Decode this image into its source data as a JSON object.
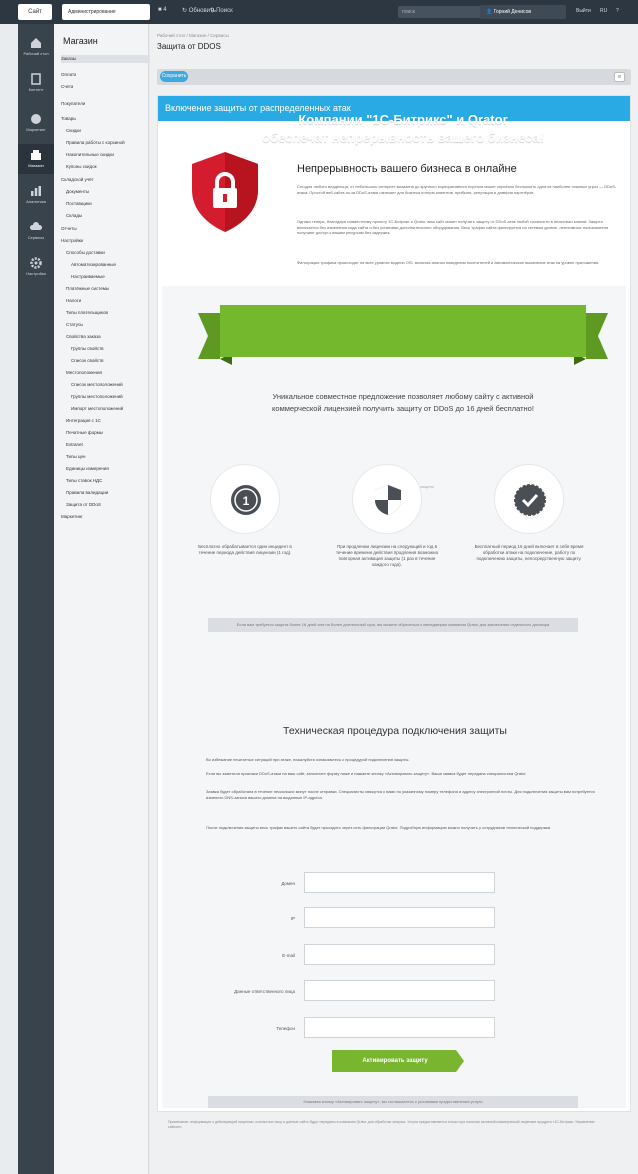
{
  "topbar": {
    "site_btn": "Сайт",
    "admin_btn": "Администрирование",
    "icons": [
      "4",
      "Обновить",
      "Поиск"
    ],
    "search_placeholder": "поиск",
    "user": "Горний Денисов",
    "right_links": [
      "Выйти",
      "RU",
      "?"
    ]
  },
  "leftbar": {
    "items": [
      {
        "label": "Рабочий стол",
        "icon": "home-icon"
      },
      {
        "label": "Контент",
        "icon": "document-icon"
      },
      {
        "label": "Маркетинг",
        "icon": "marketing-icon"
      },
      {
        "label": "Магазин",
        "icon": "store-icon"
      },
      {
        "label": "Аналитика",
        "icon": "chart-icon"
      },
      {
        "label": "Сервисы",
        "icon": "cloud-icon"
      },
      {
        "label": "Настройки",
        "icon": "gear-icon"
      }
    ]
  },
  "menu": {
    "title": "Магазин",
    "items": [
      "Заказы",
      "Оплата",
      "Счета",
      "Покупатели",
      "Товары",
      "Скидки",
      "Правила работы с корзиной",
      "Накопительные скидки",
      "Купоны скидок",
      "Складской учёт",
      "Документы",
      "Поставщики",
      "Склады",
      "Отчеты",
      "Настройки",
      "Способы доставки",
      "Автоматизированные",
      "Настраиваемые",
      "Платёжные системы",
      "Налоги",
      "Типы плательщиков",
      "Статусы",
      "Свойства заказа",
      "Группы свойств",
      "Список свойств",
      "Местоположения",
      "Список местоположений",
      "Группы местоположений",
      "Импорт местоположений",
      "Интеграция с 1С",
      "Печатные формы",
      "Extranet",
      "Типы цен",
      "Единицы измерения",
      "Типы ставок НДС",
      "Правила валидации",
      "Защита от DDoS",
      "Маркетинг"
    ]
  },
  "header": {
    "breadcrumb": "Рабочий стол  /  Магазин  /  Сервисы",
    "title": "Защита от DDOS",
    "save_label": "Сохранить",
    "menu_btn": "☰"
  },
  "panel": {
    "banner": "Включение защиты от распределенных атак",
    "intro_title": "Непрерывность вашего бизнеса в онлайне",
    "intro_p1": "Сегодня любого владельца, от небольшого интернет-магазина до крупного корпоративного портала может серьёзно беспокоить одна из наиболее опасных угроз — DDoS-атака. Простой веб-сайта из-за DDoS-атаки означает для бизнеса потерю клиентов, прибыли, репутации и доверия партнёров.",
    "intro_p2": "Однако теперь, благодаря совместному проекту 1С-Битрикс и Qrator, ваш сайт может получать защиту от DDoS-атак любой сложности в несколько кликов. Защита включается без изменения кода сайта и без установки дополнительного оборудования. Весь трафик сайта фильтруется на сетевом уровне, легитимные пользователи получают доступ к вашим ресурсам без задержек.",
    "intro_p3": "Фильтрация трафика происходит на всех уровнях модели OSI, включая анализ поведения посетителей и автоматическое выявление атак на уровне приложения.",
    "ribbon_line1": "Компании \"1С-Битрикс\" и Qrator",
    "ribbon_line2": "обеспечат непрерывность вашего бизнеса!",
    "offer_line1": "Уникальное совместное предложение позволяет любому сайту с активной",
    "offer_line2": "коммерческой лицензией получить защиту от DDoS до 16 дней бесплатно!",
    "offer_note": "Условия предоставления защиты",
    "features": [
      {
        "text": "Бесплатно обрабатывается один инцидент в течение периода действия лицензии (1 год)."
      },
      {
        "text": "При продлении лицензии на следующий и год в течение времени действия продления возможна повторная активация защиты (1 раз в течение каждого года)."
      },
      {
        "text": "Бесплатный период 16 дней включает в себя время обработки атаки на подключение, работу по подключению защиты, непосредственную защиту."
      }
    ],
    "note_bar": "Если вам требуется защита более 16 дней или на более длительный срок, вы можете обратиться к менеджерам компании Qrator для заключения отдельного договора",
    "tech_title": "Техническая процедура подключения защиты",
    "tech_p1": "Во избежание нештатных ситуаций при атаке, пожалуйста ознакомьтесь с процедурой подключения защиты.",
    "tech_p2": "Если вы заметили признаки DDoS-атаки на ваш сайт, заполните форму ниже и нажмите кнопку «Активировать защиту». Ваша заявка будет передана специалистам Qrator.",
    "tech_p3": "Заявка будет обработана в течение нескольких минут после отправки. Специалисты свяжутся с вами по указанному номеру телефона и адресу электронной почты. Для подключения защиты вам потребуется изменить DNS-записи вашего домена на выданные IP-адреса.",
    "tech_p4": "После подключения защиты весь трафик вашего сайта будет проходить через сеть фильтрации Qrator. Подробную информацию можно получить у сотрудников технической поддержки.",
    "form": {
      "domain": "Домен",
      "ip": "IP",
      "email": "E-mail",
      "contact": "Данные ответственного лица",
      "phone": "Телефон"
    },
    "activate_btn": "Активировать защиту",
    "bottom_bar": "Нажимая кнопку «Активировать защиту», вы соглашаетесь с условиями предоставления услуги",
    "footnote": "Примечание: информация о действующей лицензии, контактное лицо и данные сайта будут переданы в компанию Qrator для обработки запроса. Услуга предоставляется только при наличии активной коммерческой лицензии продукта «1С-Битрикс: Управление сайтом»."
  },
  "colors": {
    "accent_blue": "#2aaae4",
    "ribbon_green": "#74b82e",
    "shield_red": "#d31d2e",
    "button_green": "#7ab52f"
  }
}
